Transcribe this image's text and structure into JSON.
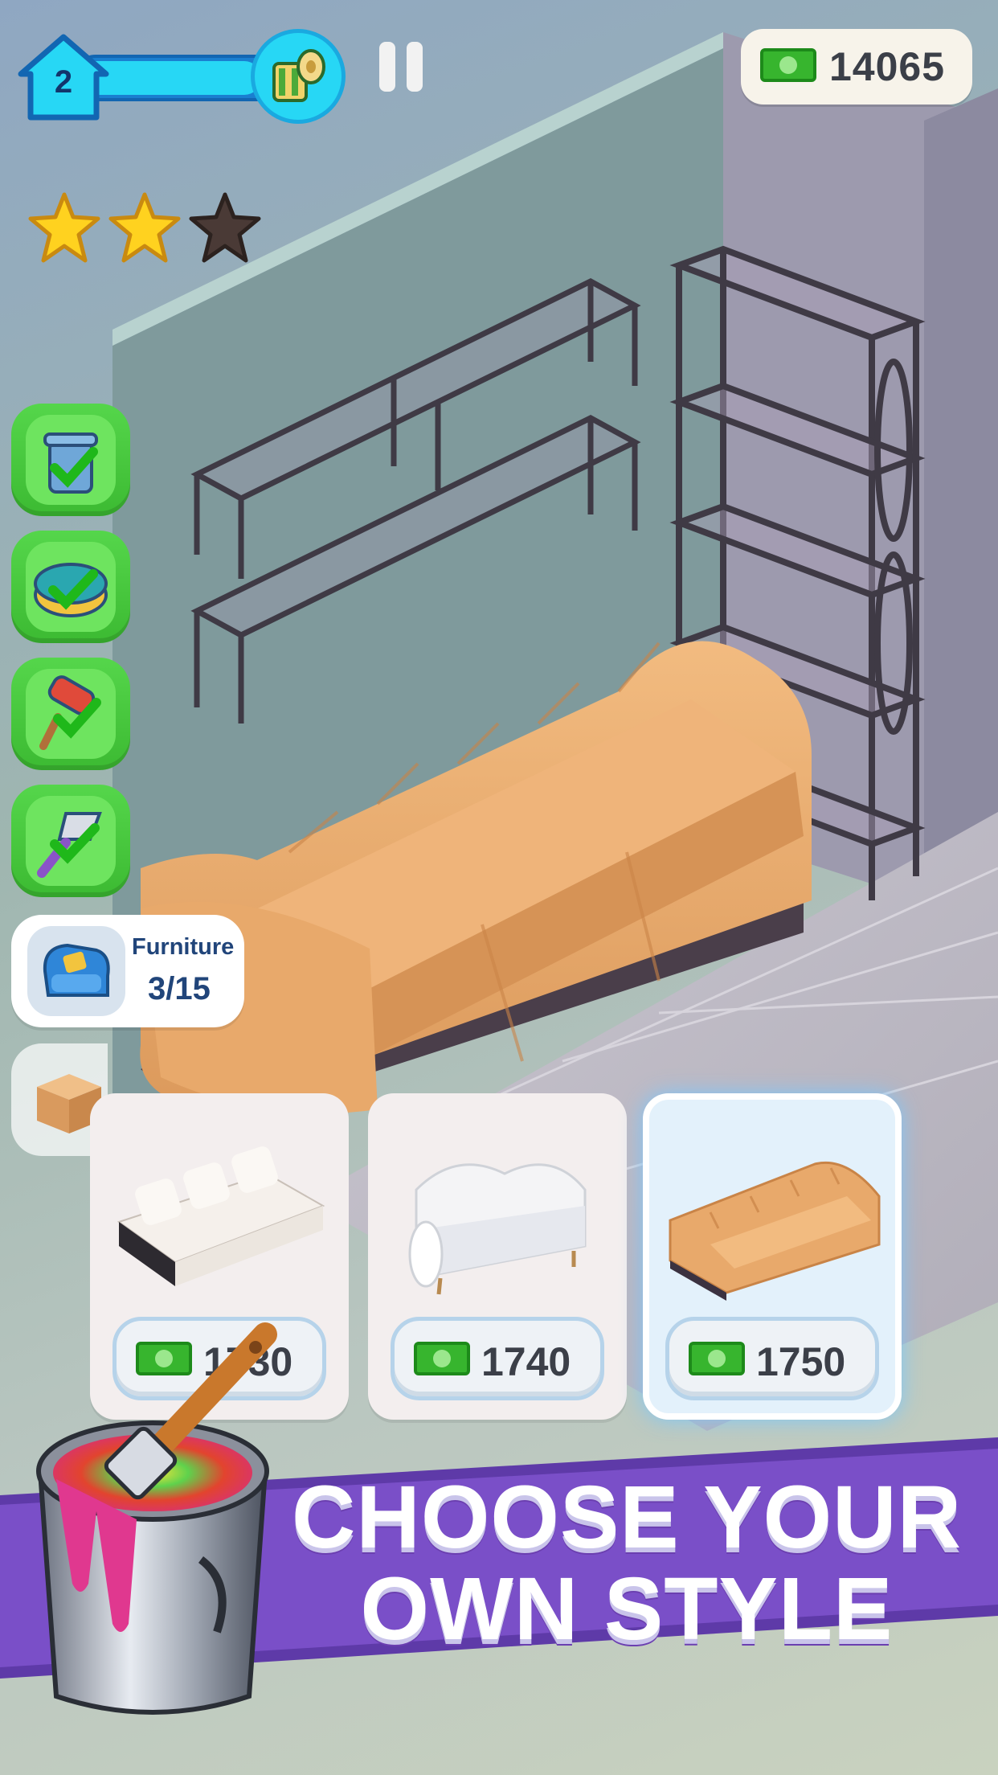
{
  "hud": {
    "level": "2",
    "level_progress": 0.8,
    "reward_icon": "wallpaper-roll-icon",
    "pause_icon": "pause-icon",
    "cash_icon": "cash-icon",
    "cash": "14065",
    "stars_earned": 2,
    "stars_total": 3
  },
  "tasks": [
    {
      "icon": "trash-can-icon",
      "status": "completed"
    },
    {
      "icon": "sponge-icon",
      "status": "completed"
    },
    {
      "icon": "paint-roller-icon",
      "status": "completed"
    },
    {
      "icon": "scraper-icon",
      "status": "completed"
    }
  ],
  "furniture_progress": {
    "label": "Furniture",
    "count": "3/15",
    "icon": "armchair-icon"
  },
  "box_icon": "cardboard-box-icon",
  "options": [
    {
      "name": "white-sofa-with-black-legs",
      "price": "1730",
      "selected": false
    },
    {
      "name": "white-tufted-sofa",
      "price": "1740",
      "selected": false
    },
    {
      "name": "orange-channel-sofa",
      "price": "1750",
      "selected": true
    }
  ],
  "banner": {
    "line1": "CHOOSE YOUR",
    "line2": "OWN STYLE",
    "icon": "paint-bucket-icon"
  },
  "colors": {
    "banner_purple": "#7a4fc8",
    "task_green": "#45c93b",
    "level_cyan": "#27d7f5",
    "cash_green": "#37b52e",
    "sofa_orange": "#e8a96b"
  }
}
